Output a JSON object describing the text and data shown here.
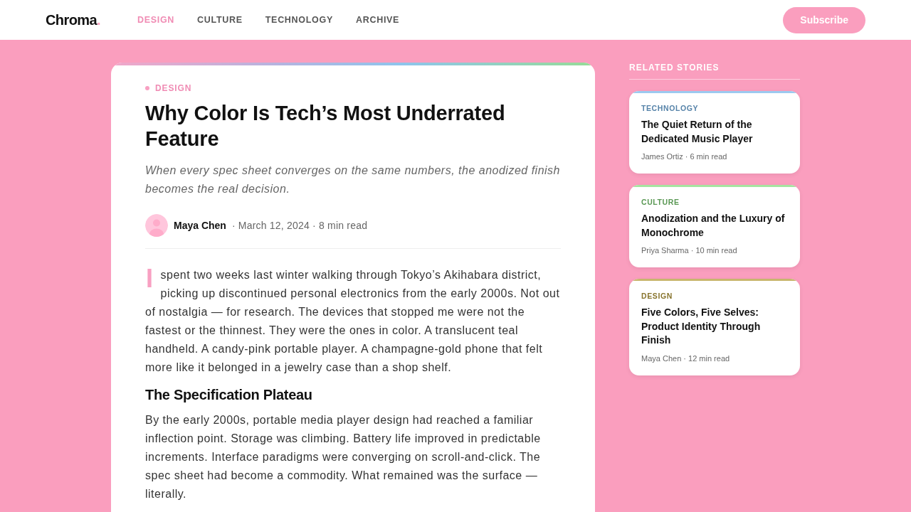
{
  "header": {
    "logo": {
      "name": "Chroma",
      "mark": "."
    },
    "nav": [
      {
        "label": "DESIGN",
        "selected": true
      },
      {
        "label": "CULTURE",
        "selected": false
      },
      {
        "label": "TECHNOLOGY",
        "selected": false
      },
      {
        "label": "ARCHIVE",
        "selected": false
      }
    ],
    "subscribe_button": "Subscribe"
  },
  "article": {
    "category": "DESIGN",
    "title": "Why Color Is Tech’s Most Underrated Feature",
    "subtitle": "When every spec sheet converges on the same numbers, the anodized finish becomes the real decision.",
    "byline": {
      "author": "Maya Chen",
      "meta": "· March 12, 2024 · 8 min read"
    },
    "body": [
      {
        "kind": "paragraph",
        "drop_cap": true,
        "text": "I spent two weeks last winter walking through Tokyo’s Akihabara district, picking up discontinued personal electronics from the early 2000s. Not out of nostalgia — for research. The devices that stopped me were not the fastest or the thinnest. They were the ones in color. A translucent teal handheld. A candy-pink portable player. A champagne-gold phone that felt more like it belonged in a jewelry case than a shop shelf."
      },
      {
        "kind": "heading",
        "text": "The Specification Plateau"
      },
      {
        "kind": "paragraph",
        "drop_cap": false,
        "text": "By the early 2000s, portable media player design had reached a familiar inflection point. Storage was climbing. Battery life improved in predictable increments. Interface paradigms were converging on scroll-and-click. The spec sheet had become a commodity. What remained was the surface — literally."
      }
    ]
  },
  "sidebar": {
    "title": "RELATED STORIES",
    "stories": [
      {
        "category": "TECHNOLOGY",
        "color": "#9ccaf0",
        "title": "The Quiet Return of the Dedicated Music Player",
        "meta": "James Ortiz · 6 min read"
      },
      {
        "category": "CULTURE",
        "color": "#a6e3a0",
        "title": "Anodization and the Luxury of Monochrome",
        "meta": "Priya Sharma · 10 min read"
      },
      {
        "category": "DESIGN",
        "color": "#c9b66e",
        "title": "Five Colors, Five Selves: Product Identity Through Finish",
        "meta": "Maya Chen · 12 min read"
      }
    ]
  }
}
